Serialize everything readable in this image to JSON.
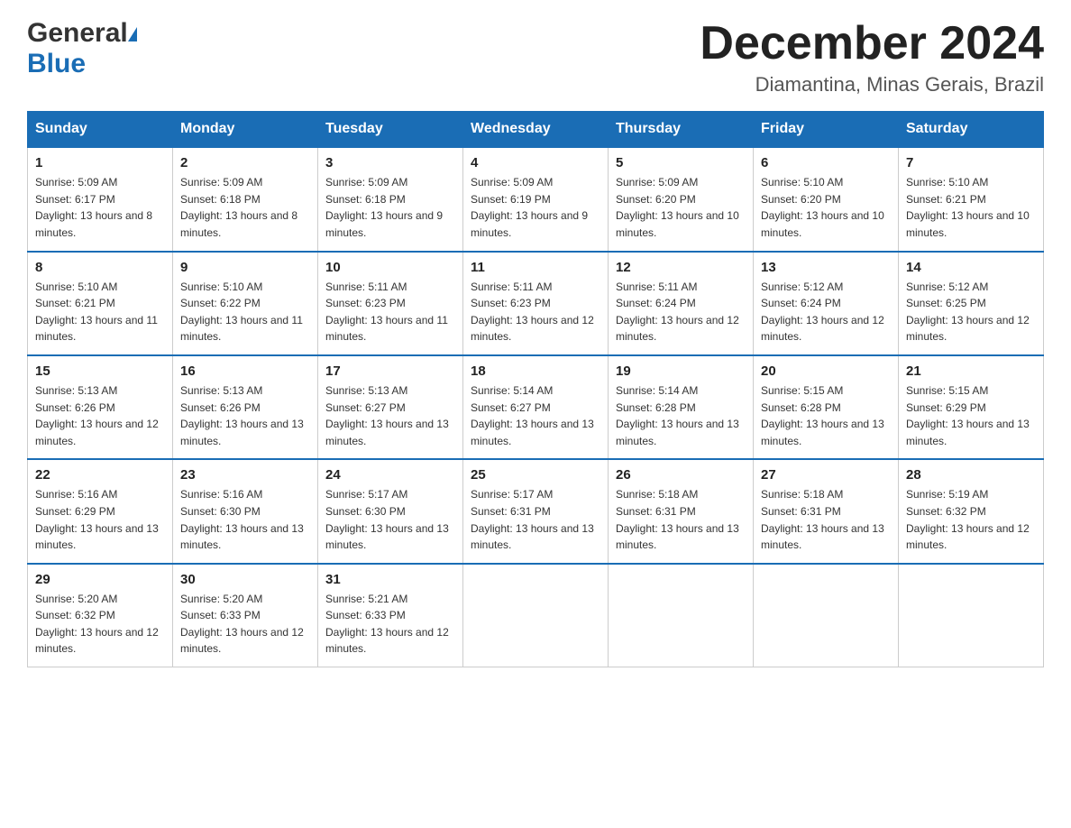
{
  "header": {
    "logo": {
      "general": "General",
      "blue": "Blue",
      "triangle_label": "logo-triangle"
    },
    "title": "December 2024",
    "location": "Diamantina, Minas Gerais, Brazil"
  },
  "calendar": {
    "weekdays": [
      "Sunday",
      "Monday",
      "Tuesday",
      "Wednesday",
      "Thursday",
      "Friday",
      "Saturday"
    ],
    "weeks": [
      [
        {
          "day": "1",
          "sunrise": "Sunrise: 5:09 AM",
          "sunset": "Sunset: 6:17 PM",
          "daylight": "Daylight: 13 hours and 8 minutes."
        },
        {
          "day": "2",
          "sunrise": "Sunrise: 5:09 AM",
          "sunset": "Sunset: 6:18 PM",
          "daylight": "Daylight: 13 hours and 8 minutes."
        },
        {
          "day": "3",
          "sunrise": "Sunrise: 5:09 AM",
          "sunset": "Sunset: 6:18 PM",
          "daylight": "Daylight: 13 hours and 9 minutes."
        },
        {
          "day": "4",
          "sunrise": "Sunrise: 5:09 AM",
          "sunset": "Sunset: 6:19 PM",
          "daylight": "Daylight: 13 hours and 9 minutes."
        },
        {
          "day": "5",
          "sunrise": "Sunrise: 5:09 AM",
          "sunset": "Sunset: 6:20 PM",
          "daylight": "Daylight: 13 hours and 10 minutes."
        },
        {
          "day": "6",
          "sunrise": "Sunrise: 5:10 AM",
          "sunset": "Sunset: 6:20 PM",
          "daylight": "Daylight: 13 hours and 10 minutes."
        },
        {
          "day": "7",
          "sunrise": "Sunrise: 5:10 AM",
          "sunset": "Sunset: 6:21 PM",
          "daylight": "Daylight: 13 hours and 10 minutes."
        }
      ],
      [
        {
          "day": "8",
          "sunrise": "Sunrise: 5:10 AM",
          "sunset": "Sunset: 6:21 PM",
          "daylight": "Daylight: 13 hours and 11 minutes."
        },
        {
          "day": "9",
          "sunrise": "Sunrise: 5:10 AM",
          "sunset": "Sunset: 6:22 PM",
          "daylight": "Daylight: 13 hours and 11 minutes."
        },
        {
          "day": "10",
          "sunrise": "Sunrise: 5:11 AM",
          "sunset": "Sunset: 6:23 PM",
          "daylight": "Daylight: 13 hours and 11 minutes."
        },
        {
          "day": "11",
          "sunrise": "Sunrise: 5:11 AM",
          "sunset": "Sunset: 6:23 PM",
          "daylight": "Daylight: 13 hours and 12 minutes."
        },
        {
          "day": "12",
          "sunrise": "Sunrise: 5:11 AM",
          "sunset": "Sunset: 6:24 PM",
          "daylight": "Daylight: 13 hours and 12 minutes."
        },
        {
          "day": "13",
          "sunrise": "Sunrise: 5:12 AM",
          "sunset": "Sunset: 6:24 PM",
          "daylight": "Daylight: 13 hours and 12 minutes."
        },
        {
          "day": "14",
          "sunrise": "Sunrise: 5:12 AM",
          "sunset": "Sunset: 6:25 PM",
          "daylight": "Daylight: 13 hours and 12 minutes."
        }
      ],
      [
        {
          "day": "15",
          "sunrise": "Sunrise: 5:13 AM",
          "sunset": "Sunset: 6:26 PM",
          "daylight": "Daylight: 13 hours and 12 minutes."
        },
        {
          "day": "16",
          "sunrise": "Sunrise: 5:13 AM",
          "sunset": "Sunset: 6:26 PM",
          "daylight": "Daylight: 13 hours and 13 minutes."
        },
        {
          "day": "17",
          "sunrise": "Sunrise: 5:13 AM",
          "sunset": "Sunset: 6:27 PM",
          "daylight": "Daylight: 13 hours and 13 minutes."
        },
        {
          "day": "18",
          "sunrise": "Sunrise: 5:14 AM",
          "sunset": "Sunset: 6:27 PM",
          "daylight": "Daylight: 13 hours and 13 minutes."
        },
        {
          "day": "19",
          "sunrise": "Sunrise: 5:14 AM",
          "sunset": "Sunset: 6:28 PM",
          "daylight": "Daylight: 13 hours and 13 minutes."
        },
        {
          "day": "20",
          "sunrise": "Sunrise: 5:15 AM",
          "sunset": "Sunset: 6:28 PM",
          "daylight": "Daylight: 13 hours and 13 minutes."
        },
        {
          "day": "21",
          "sunrise": "Sunrise: 5:15 AM",
          "sunset": "Sunset: 6:29 PM",
          "daylight": "Daylight: 13 hours and 13 minutes."
        }
      ],
      [
        {
          "day": "22",
          "sunrise": "Sunrise: 5:16 AM",
          "sunset": "Sunset: 6:29 PM",
          "daylight": "Daylight: 13 hours and 13 minutes."
        },
        {
          "day": "23",
          "sunrise": "Sunrise: 5:16 AM",
          "sunset": "Sunset: 6:30 PM",
          "daylight": "Daylight: 13 hours and 13 minutes."
        },
        {
          "day": "24",
          "sunrise": "Sunrise: 5:17 AM",
          "sunset": "Sunset: 6:30 PM",
          "daylight": "Daylight: 13 hours and 13 minutes."
        },
        {
          "day": "25",
          "sunrise": "Sunrise: 5:17 AM",
          "sunset": "Sunset: 6:31 PM",
          "daylight": "Daylight: 13 hours and 13 minutes."
        },
        {
          "day": "26",
          "sunrise": "Sunrise: 5:18 AM",
          "sunset": "Sunset: 6:31 PM",
          "daylight": "Daylight: 13 hours and 13 minutes."
        },
        {
          "day": "27",
          "sunrise": "Sunrise: 5:18 AM",
          "sunset": "Sunset: 6:31 PM",
          "daylight": "Daylight: 13 hours and 13 minutes."
        },
        {
          "day": "28",
          "sunrise": "Sunrise: 5:19 AM",
          "sunset": "Sunset: 6:32 PM",
          "daylight": "Daylight: 13 hours and 12 minutes."
        }
      ],
      [
        {
          "day": "29",
          "sunrise": "Sunrise: 5:20 AM",
          "sunset": "Sunset: 6:32 PM",
          "daylight": "Daylight: 13 hours and 12 minutes."
        },
        {
          "day": "30",
          "sunrise": "Sunrise: 5:20 AM",
          "sunset": "Sunset: 6:33 PM",
          "daylight": "Daylight: 13 hours and 12 minutes."
        },
        {
          "day": "31",
          "sunrise": "Sunrise: 5:21 AM",
          "sunset": "Sunset: 6:33 PM",
          "daylight": "Daylight: 13 hours and 12 minutes."
        },
        null,
        null,
        null,
        null
      ]
    ]
  }
}
